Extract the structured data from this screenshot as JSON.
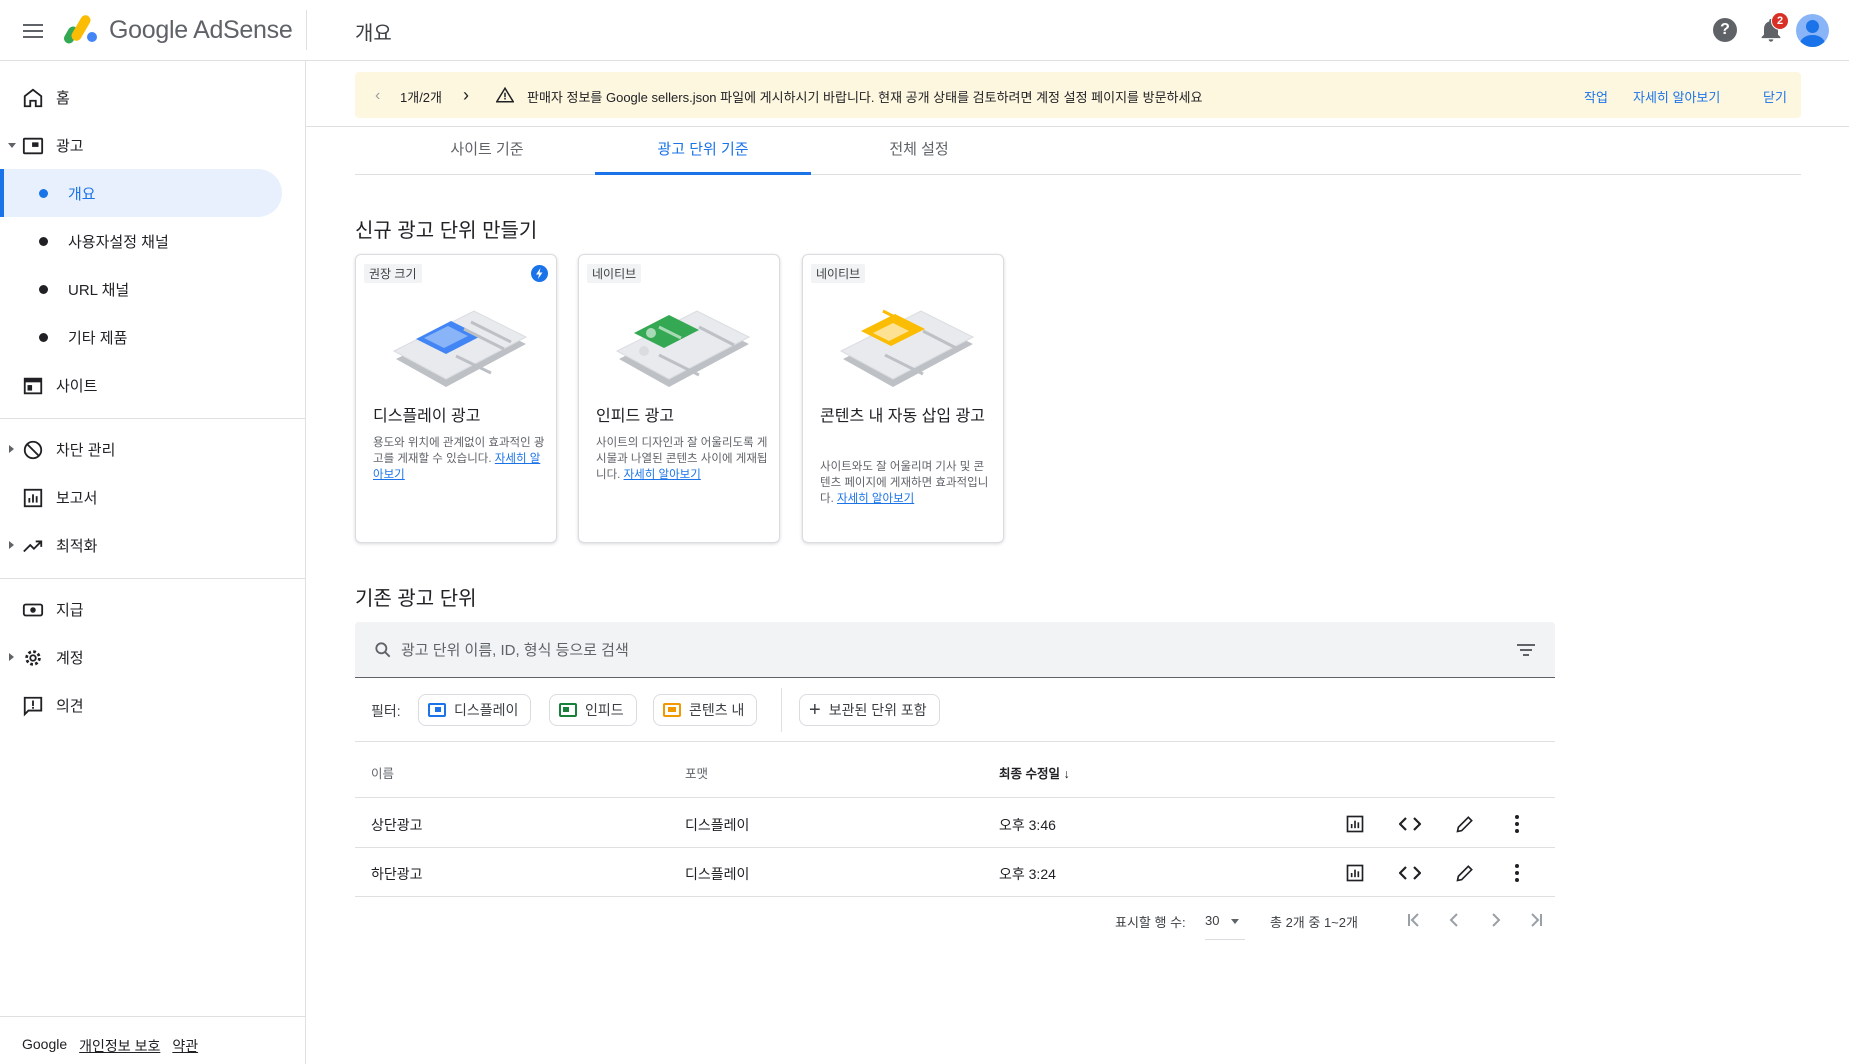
{
  "header": {
    "brand": "Google AdSense",
    "page_title": "개요",
    "notification_count": "2",
    "help_glyph": "?"
  },
  "sidebar": {
    "items": [
      {
        "label": "홈",
        "icon": "home-icon"
      },
      {
        "label": "광고",
        "icon": "ads-icon"
      },
      {
        "label": "개요"
      },
      {
        "label": "사용자설정 채널"
      },
      {
        "label": "URL 채널"
      },
      {
        "label": "기타 제품"
      },
      {
        "label": "사이트",
        "icon": "sites-icon"
      },
      {
        "label": "차단 관리",
        "icon": "block-icon"
      },
      {
        "label": "보고서",
        "icon": "reports-icon"
      },
      {
        "label": "최적화",
        "icon": "optimize-icon"
      },
      {
        "label": "지급",
        "icon": "payments-icon"
      },
      {
        "label": "계정",
        "icon": "gear-icon"
      },
      {
        "label": "의견",
        "icon": "feedback-icon"
      }
    ],
    "footer": {
      "google": "Google",
      "privacy": "개인정보 보호",
      "terms": "약관"
    }
  },
  "notice": {
    "pager": "1개/2개",
    "message": "판매자 정보를 Google sellers.json 파일에 게시하시기 바랍니다. 현재 공개 상태를 검토하려면 계정 설정 페이지를 방문하세요",
    "action": "작업",
    "learn_more": "자세히 알아보기",
    "close": "닫기"
  },
  "tabs": [
    {
      "label": "사이트 기준"
    },
    {
      "label": "광고 단위 기준",
      "active": true
    },
    {
      "label": "전체 설정"
    }
  ],
  "create": {
    "heading": "신규 광고 단위 만들기",
    "cards": [
      {
        "tag": "권장 크기",
        "title": "디스플레이 광고",
        "desc": "용도와 위치에 관계없이 효과적인 광고를 게재할 수 있습니다. ",
        "link": "자세히 알아보기",
        "accent": "#4285f4"
      },
      {
        "tag": "네이티브",
        "title": "인피드 광고",
        "desc": "사이트의 디자인과 잘 어울리도록 게시물과 나열된 콘텐츠 사이에 게재됩니다. ",
        "link": "자세히 알아보기",
        "accent": "#34a853"
      },
      {
        "tag": "네이티브",
        "title": "콘텐츠 내 자동 삽입 광고",
        "desc": "사이트와도 잘 어울리며 기사 및 콘텐츠 페이지에 게재하면 효과적입니다. ",
        "link": "자세히 알아보기",
        "accent": "#fbbc04"
      }
    ]
  },
  "existing": {
    "heading": "기존 광고 단위",
    "search_placeholder": "광고 단위 이름, ID, 형식 등으로 검색",
    "filter_label": "필터:",
    "chips": [
      {
        "label": "디스플레이",
        "color": "#1a73e8"
      },
      {
        "label": "인피드",
        "color": "#188038"
      },
      {
        "label": "콘텐츠 내",
        "color": "#f29900"
      }
    ],
    "archived_chip": "보관된 단위 포함",
    "columns": {
      "name": "이름",
      "format": "포맷",
      "modified": "최종 수정일"
    },
    "rows": [
      {
        "name": "상단광고",
        "format": "디스플레이",
        "modified": "오후 3:46"
      },
      {
        "name": "하단광고",
        "format": "디스플레이",
        "modified": "오후 3:24"
      }
    ],
    "pagination": {
      "rows_label": "표시할 행 수:",
      "rows_value": "30",
      "range": "총 2개 중 1~2개"
    }
  }
}
